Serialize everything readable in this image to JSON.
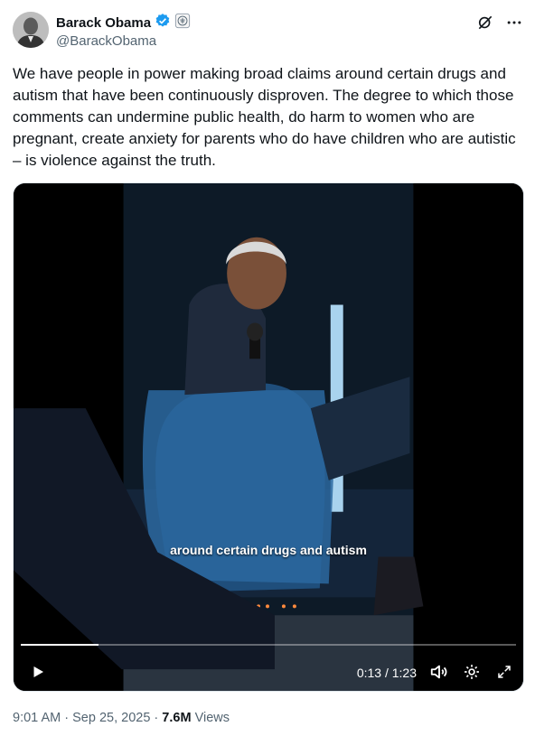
{
  "author": {
    "display_name": "Barack Obama",
    "handle": "@BarackObama",
    "verified_badge_color": "#1d9bf0",
    "icons": [
      "verified-badge-icon",
      "government-seal-icon",
      "grok-icon",
      "more-icon"
    ]
  },
  "tweet": {
    "text": "We have people in power making broad claims around certain drugs and autism that have been continuously disproven. The degree to which those comments can undermine public health, do harm to women who are pregnant, create anxiety for parents who do have children who are autistic – is violence against the truth."
  },
  "video": {
    "caption": "around certain drugs and autism",
    "time_display": "0:13 / 1:23",
    "progress_fraction": 0.157,
    "icons": [
      "play-icon",
      "volume-icon",
      "settings-icon",
      "fullscreen-icon"
    ]
  },
  "meta": {
    "time": "9:01 AM",
    "separator": "·",
    "date": "Sep 25, 2025",
    "views_count": "7.6M",
    "views_label": "Views"
  }
}
